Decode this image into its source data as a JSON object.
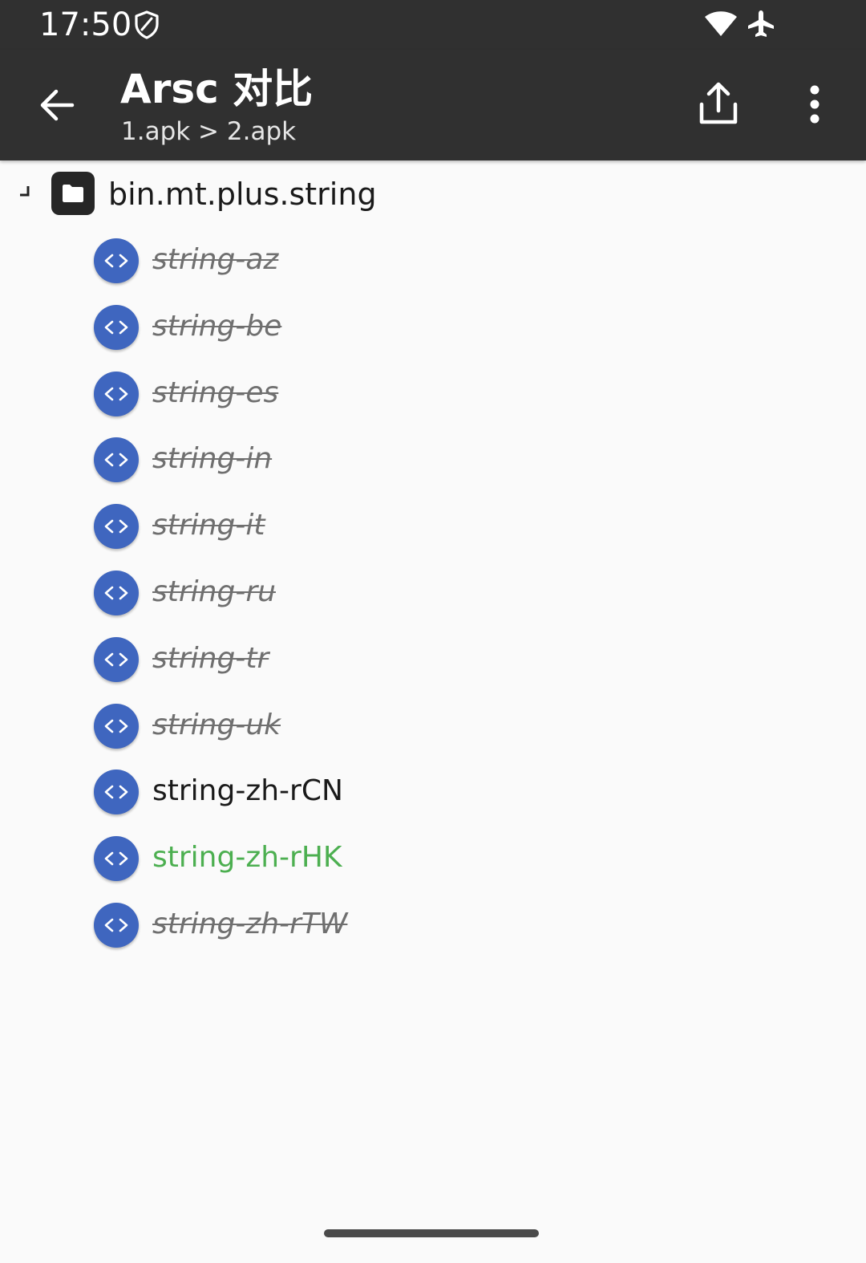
{
  "status_bar": {
    "time": "17:50",
    "icons": [
      "shield-icon",
      "wifi-icon",
      "airplane-icon"
    ]
  },
  "toolbar": {
    "title": "Arsc 对比",
    "subtitle": "1.apk > 2.apk",
    "back_icon": "arrow-back-icon",
    "share_icon": "share-icon",
    "more_icon": "more-vert-icon"
  },
  "tree": {
    "root": {
      "label": "bin.mt.plus.string",
      "icon": "folder-icon",
      "expanded": true
    },
    "items": [
      {
        "label": "string-az",
        "status": "removed",
        "icon": "xml-icon"
      },
      {
        "label": "string-be",
        "status": "removed",
        "icon": "xml-icon"
      },
      {
        "label": "string-es",
        "status": "removed",
        "icon": "xml-icon"
      },
      {
        "label": "string-in",
        "status": "removed",
        "icon": "xml-icon"
      },
      {
        "label": "string-it",
        "status": "removed",
        "icon": "xml-icon"
      },
      {
        "label": "string-ru",
        "status": "removed",
        "icon": "xml-icon"
      },
      {
        "label": "string-tr",
        "status": "removed",
        "icon": "xml-icon"
      },
      {
        "label": "string-uk",
        "status": "removed",
        "icon": "xml-icon"
      },
      {
        "label": "string-zh-rCN",
        "status": "normal",
        "icon": "xml-icon"
      },
      {
        "label": "string-zh-rHK",
        "status": "added",
        "icon": "xml-icon"
      },
      {
        "label": "string-zh-rTW",
        "status": "removed",
        "icon": "xml-icon"
      }
    ]
  },
  "colors": {
    "bar": "#303030",
    "background": "#fafafa",
    "badge": "#3f66bf",
    "removed_text": "#6f6f6f",
    "added_text": "#4caf50",
    "normal_text": "#1a1a1a"
  }
}
